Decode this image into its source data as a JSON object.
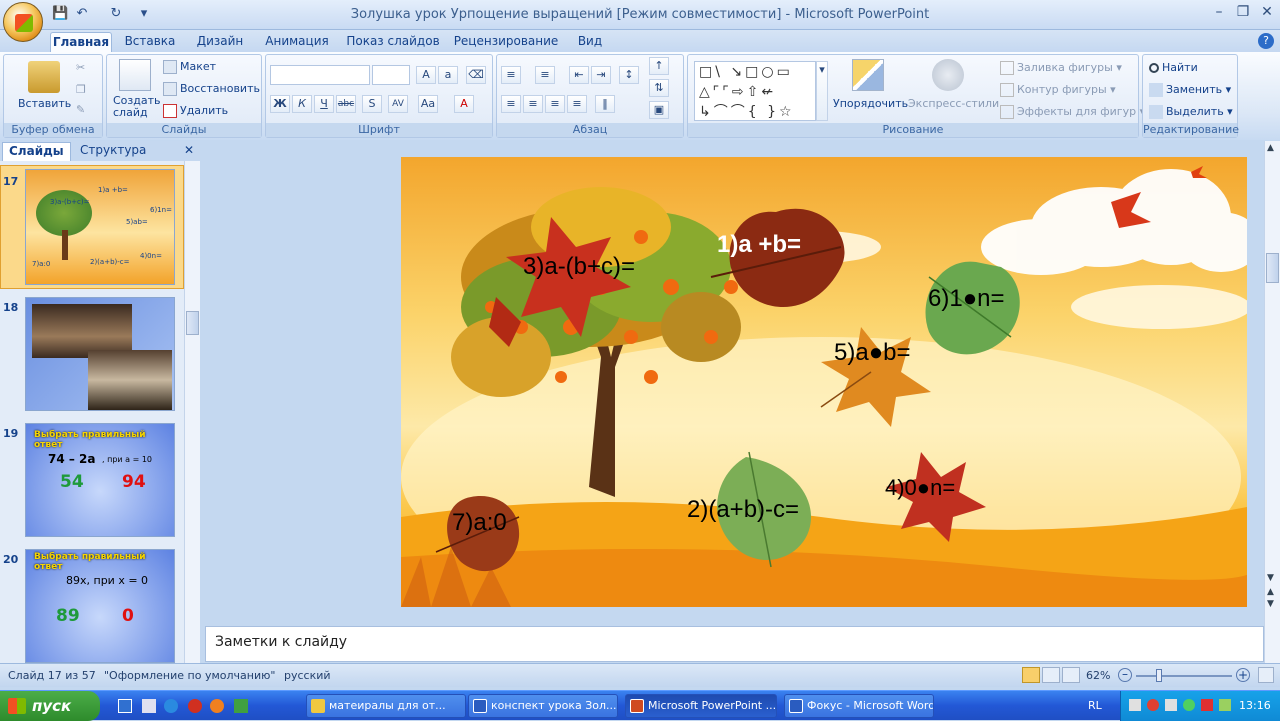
{
  "window": {
    "title": "Золушка урок Урпощение выращений [Режим совместимости] - Microsoft PowerPoint"
  },
  "tabs": [
    "Главная",
    "Вставка",
    "Дизайн",
    "Анимация",
    "Показ слайдов",
    "Рецензирование",
    "Вид"
  ],
  "ribbon": {
    "clipboard": {
      "label": "Буфер обмена",
      "paste": "Вставить"
    },
    "slides": {
      "label": "Слайды",
      "new_slide": "Создать слайд",
      "layout": "Макет",
      "reset": "Восстановить",
      "delete": "Удалить"
    },
    "font": {
      "label": "Шрифт"
    },
    "paragraph": {
      "label": "Абзац"
    },
    "drawing": {
      "label": "Рисование",
      "arrange": "Упорядочить",
      "quick_styles": "Экспресс-стили",
      "shape_fill": "Заливка фигуры",
      "shape_outline": "Контур фигуры",
      "shape_effects": "Эффекты для фигур"
    },
    "editing": {
      "label": "Редактирование",
      "find": "Найти",
      "replace": "Заменить",
      "select": "Выделить"
    }
  },
  "pane": {
    "tab_slides": "Слайды",
    "tab_outline": "Структура",
    "thumbnails": [
      {
        "num": "17",
        "labels": [
          "1)a +b=",
          "3)a-(b+c)=",
          "6)1n=",
          "5)ab=",
          "7)a:0",
          "2)(a+b)-c=",
          "4)0n="
        ]
      },
      {
        "num": "18"
      },
      {
        "num": "19",
        "header": "Выбрать правильный ответ",
        "expr": "74 – 2a",
        "cond": ", при а = 10",
        "answer_left": "54",
        "answer_right": "94"
      },
      {
        "num": "20",
        "header": "Выбрать правильный ответ",
        "expr": "89x, при x = 0",
        "answer_left": "89",
        "answer_right": "0"
      }
    ]
  },
  "slide": {
    "leaves": [
      {
        "label": "1)a +b=",
        "color": "#8b2a12"
      },
      {
        "label": "3)a-(b+c)=",
        "color": "#c8301e"
      },
      {
        "label": "6)1●n=",
        "color": "#6aa84f"
      },
      {
        "label": "5)a●b=",
        "color": "#e08a20"
      },
      {
        "label": "7)a:0",
        "color": "#9a3a18"
      },
      {
        "label": "2)(a+b)-c=",
        "color": "#7cae56"
      },
      {
        "label": "4)0●n=",
        "color": "#c03020"
      }
    ]
  },
  "notes": {
    "placeholder": "Заметки к слайду"
  },
  "status": {
    "slide_info": "Слайд 17 из 57",
    "theme": "\"Оформление по умолчанию\"",
    "language": "русский",
    "zoom": "62%"
  },
  "taskbar": {
    "start": "пуск",
    "tasks": [
      "матеиралы для от...",
      "конспект урока Зол...",
      "Microsoft PowerPoint ...",
      "Фокус - Microsoft Word"
    ],
    "lang": "RL",
    "clock": "13:16"
  }
}
